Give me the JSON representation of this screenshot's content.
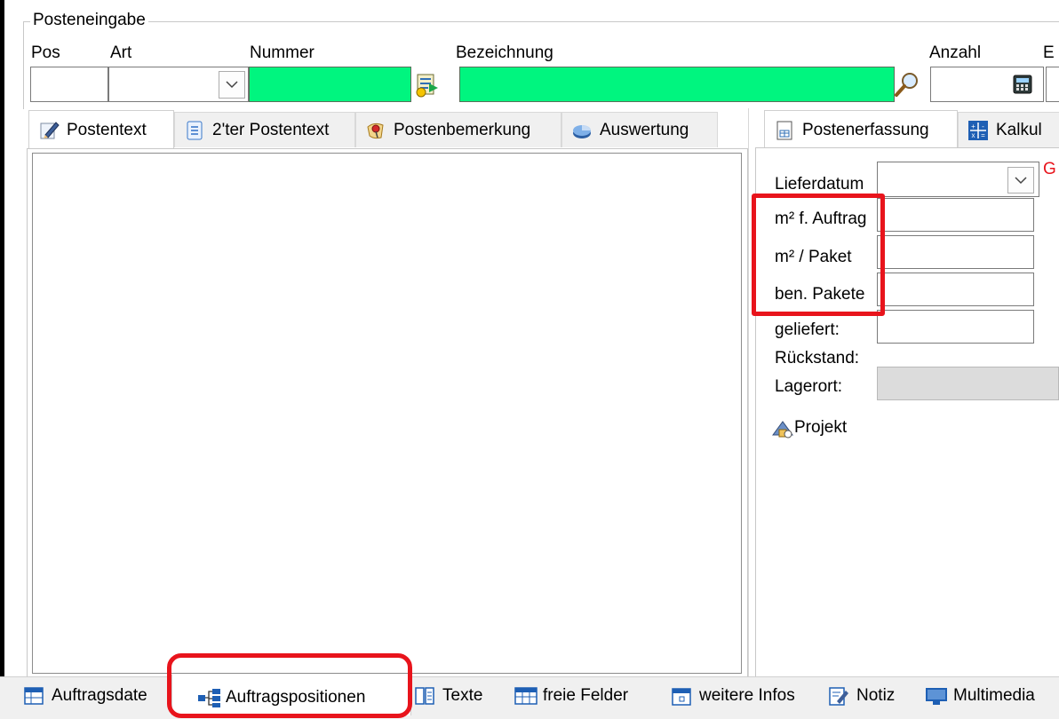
{
  "group": {
    "title": "Posteneingabe"
  },
  "header": {
    "pos_label": "Pos",
    "art_label": "Art",
    "nummer_label": "Nummer",
    "bezeichnung_label": "Bezeichnung",
    "anzahl_label": "Anzahl",
    "e_label": "E"
  },
  "left_tabs": [
    {
      "label": "Postentext",
      "icon": "pencil-icon",
      "active": true
    },
    {
      "label": "2'ter Postentext",
      "icon": "document-icon",
      "active": false
    },
    {
      "label": "Postenbemerkung",
      "icon": "note-pin-icon",
      "active": false
    },
    {
      "label": "Auswertung",
      "icon": "pie-chart-icon",
      "active": false
    }
  ],
  "right_tabs": [
    {
      "label": "Postenerfassung",
      "icon": "form-icon",
      "active": true
    },
    {
      "label": "Kalkul",
      "icon": "calculator-icon",
      "active": false
    }
  ],
  "right_fields": {
    "lieferdatum": "Lieferdatum",
    "red_letter": "G",
    "m2_auftrag": "m² f. Auftrag",
    "m2_paket": "m² / Paket",
    "ben_pakete": "ben. Pakete",
    "geliefert": "geliefert:",
    "rueckstand": "Rückstand:",
    "lagerort": "Lagerort:",
    "projekt": "Projekt"
  },
  "bottom_tabs": [
    {
      "label": "Auftragsdate",
      "icon": "table-icon"
    },
    {
      "label": "Auftragspositionen",
      "icon": "hierarchy-icon",
      "active": true
    },
    {
      "label": "Texte",
      "icon": "book-icon"
    },
    {
      "label": "freie Felder",
      "icon": "grid-icon"
    },
    {
      "label": "weitere Infos",
      "icon": "calendar-icon"
    },
    {
      "label": "Notiz",
      "icon": "edit-note-icon"
    },
    {
      "label": "Multimedia",
      "icon": "monitor-icon"
    }
  ],
  "colors": {
    "highlight": "#e8141c",
    "green_field": "#00f57f",
    "accent_blue": "#1e5fb4"
  }
}
